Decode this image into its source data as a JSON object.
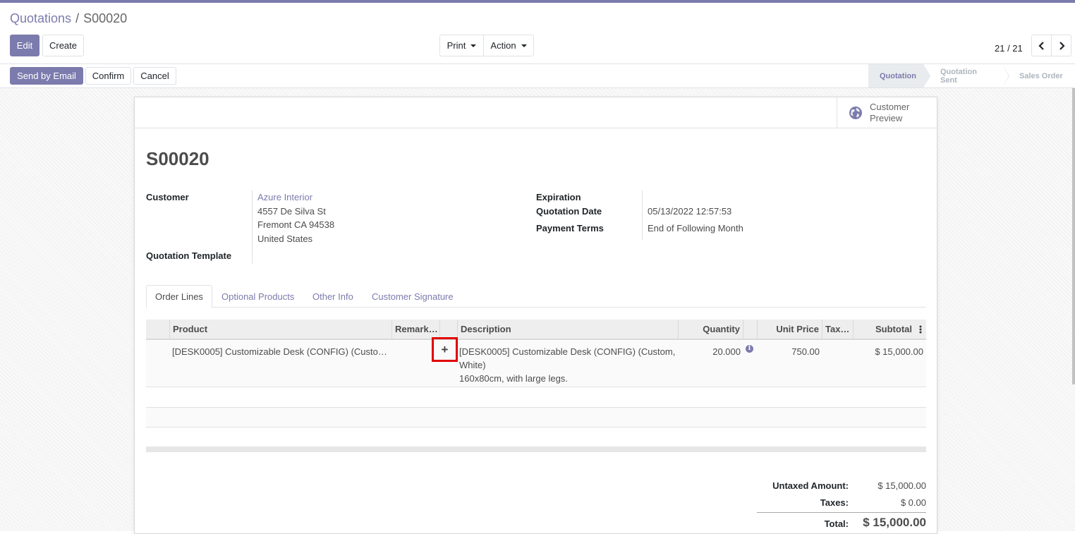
{
  "breadcrumb": {
    "parent": "Quotations",
    "separator": "/",
    "current": "S00020"
  },
  "toolbar": {
    "edit": "Edit",
    "create": "Create",
    "print": "Print",
    "action": "Action"
  },
  "pager": {
    "value": "21 / 21"
  },
  "status_buttons": {
    "send_email": "Send by Email",
    "confirm": "Confirm",
    "cancel": "Cancel"
  },
  "statusbar": {
    "steps": [
      "Quotation",
      "Quotation Sent",
      "Sales Order"
    ],
    "active": "Quotation"
  },
  "smart_button": {
    "label_line1": "Customer",
    "label_line2": "Preview",
    "icon": "globe-icon"
  },
  "document": {
    "title": "S00020"
  },
  "fields": {
    "customer_label": "Customer",
    "customer_name": "Azure Interior",
    "customer_address1": "4557 De Silva St",
    "customer_address2": "Fremont CA 94538",
    "customer_country": "United States",
    "template_label": "Quotation Template",
    "expiration_label": "Expiration",
    "quotation_date_label": "Quotation Date",
    "quotation_date_value": "05/13/2022 12:57:53",
    "payment_terms_label": "Payment Terms",
    "payment_terms_value": "End of Following Month"
  },
  "tabs": [
    "Order Lines",
    "Optional Products",
    "Other Info",
    "Customer Signature"
  ],
  "order_lines": {
    "columns": [
      "Product",
      "Remark…",
      "Description",
      "Quantity",
      "Unit Price",
      "Tax…",
      "Subtotal"
    ],
    "rows": [
      {
        "product": "[DESK0005] Customizable Desk (CONFIG) (Custo…",
        "description_line1": "[DESK0005] Customizable Desk (CONFIG) (Custom,",
        "description_line2": "White)",
        "description_line3": "160x80cm, with large legs.",
        "quantity": "20.000",
        "unit_price": "750.00",
        "subtotal": "$ 15,000.00"
      }
    ],
    "add_line_icon": "plus-icon"
  },
  "totals": {
    "untaxed_label": "Untaxed Amount:",
    "untaxed_value": "$ 15,000.00",
    "taxes_label": "Taxes:",
    "taxes_value": "$ 0.00",
    "total_label": "Total:",
    "total_value": "$ 15,000.00"
  },
  "colors": {
    "brand": "#7c7bad",
    "highlight": "#e00000"
  }
}
